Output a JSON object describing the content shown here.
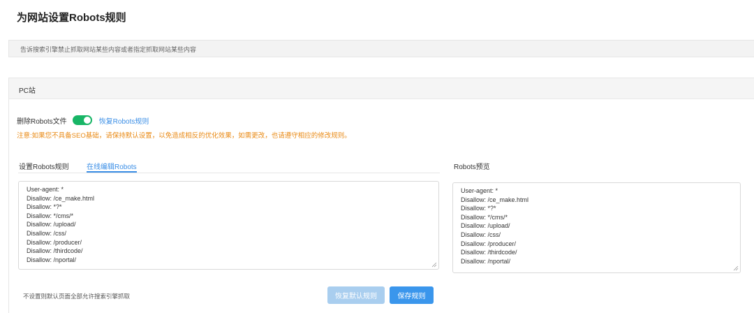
{
  "page": {
    "title": "为网站设置Robots规则"
  },
  "notice": {
    "text": "告诉搜索引擎禁止抓取网站某些内容或者指定抓取网站某些内容"
  },
  "card": {
    "title": "PC站"
  },
  "delete_robots": {
    "label": "删除Robots文件",
    "toggle_on": true,
    "restore_link": "恢复Robots规则"
  },
  "warning": "注意:如果您不具备SEO基础，请保持默认设置，以免造成相反的优化效果，如需更改，也请遵守相应的修改规则。",
  "tabs": [
    {
      "label": "设置Robots规则",
      "active": false
    },
    {
      "label": "在线编辑Robots",
      "active": true
    }
  ],
  "editor": {
    "lines": [
      "User-agent: *",
      "Disallow: /ce_make.html",
      "Disallow: *?*",
      "Disallow: */cms/*",
      "Disallow: /upload/",
      "Disallow: /css/",
      "Disallow: /producer/",
      "Disallow: /thirdcode/",
      "Disallow: /nportal/"
    ]
  },
  "preview": {
    "title": "Robots预览",
    "lines": [
      "User-agent: *",
      "Disallow: /ce_make.html",
      "Disallow: *?*",
      "Disallow: */cms/*",
      "Disallow: /upload/",
      "Disallow: /css/",
      "Disallow: /producer/",
      "Disallow: /thirdcode/",
      "Disallow: /nportal/"
    ]
  },
  "footer": {
    "note": "不设置则默认页面全部允许搜索引擎抓取",
    "restore_button": "恢复默认规则",
    "save_button": "保存规则"
  },
  "colors": {
    "accent": "#3a8ee6",
    "toggle": "#18b566",
    "warning": "#e98a15",
    "button_primary": "#3a96ec",
    "button_disabled": "#a9ceef"
  }
}
